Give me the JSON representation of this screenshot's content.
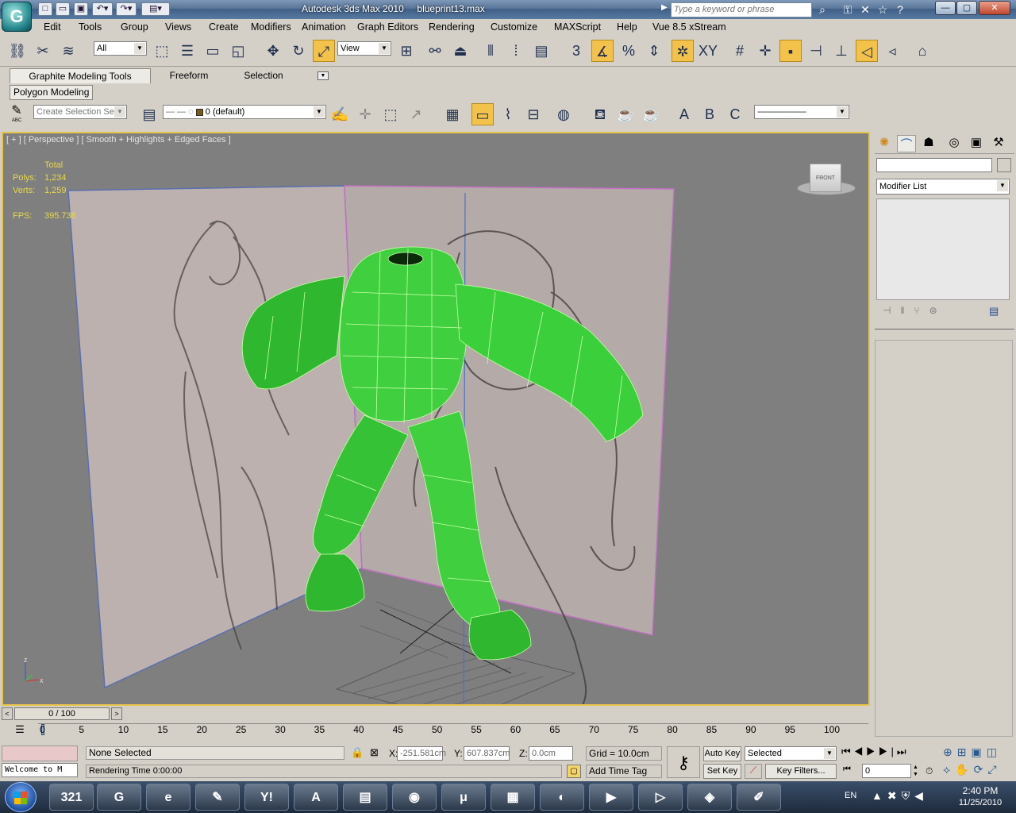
{
  "title": {
    "app": "Autodesk 3ds Max  2010",
    "file": "blueprint13.max",
    "logo": "G"
  },
  "search": {
    "placeholder": "Type a keyword or phrase"
  },
  "menu": [
    "Edit",
    "Tools",
    "Group",
    "Views",
    "Create",
    "Modifiers",
    "Animation",
    "Graph Editors",
    "Rendering",
    "Customize",
    "MAXScript",
    "Help",
    "Vue 8.5 xStream"
  ],
  "toolbar": {
    "selection_filter": "All",
    "ref_coord": "View",
    "snap_3": "3"
  },
  "ribbon": {
    "tabs": [
      "Graphite Modeling Tools",
      "Freeform",
      "Selection"
    ],
    "panel": "Polygon Modeling"
  },
  "toolbar2": {
    "selection_set_placeholder": "Create Selection Se",
    "layer": "0 (default)",
    "abc_label": "ABC"
  },
  "viewport": {
    "label": "[ + ] [ Perspective ] [ Smooth + Highlights + Edged Faces ]",
    "stats": {
      "total": "Total",
      "polys_label": "Polys:",
      "polys": "1,234",
      "verts_label": "Verts:",
      "verts": "1,259",
      "fps_label": "FPS:",
      "fps": "395.738"
    },
    "viewcube": "FRONT",
    "axes": {
      "z": "z",
      "x": "x"
    },
    "accent": "#e9c44a",
    "mesh_color": "#3fcf3f"
  },
  "command_panel": {
    "modifier_list": "Modifier List"
  },
  "timeline": {
    "frame": "0 / 100",
    "ticks": [
      "0",
      "5",
      "10",
      "15",
      "20",
      "25",
      "30",
      "35",
      "40",
      "45",
      "50",
      "55",
      "60",
      "65",
      "70",
      "75",
      "80",
      "85",
      "90",
      "95",
      "100"
    ]
  },
  "status": {
    "script": "Welcome to M",
    "selection": "None Selected",
    "rendering": "Rendering Time  0:00:00",
    "x_label": "X:",
    "x": "-251.581cm",
    "y_label": "Y:",
    "y": "607.837cm",
    "z_label": "Z:",
    "z": "0.0cm",
    "grid": "Grid = 10.0cm",
    "add_time_tag": "Add Time Tag",
    "auto_key": "Auto Key",
    "set_key": "Set Key",
    "key_mode": "Selected",
    "key_filters": "Key Filters...",
    "current_frame": "0"
  },
  "taskbar": {
    "lang": "EN",
    "time": "2:40 PM",
    "date": "11/25/2010",
    "apps": [
      "321",
      "G",
      "e",
      "✎",
      "Y!",
      "A",
      "▤",
      "◉",
      "μ",
      "▦",
      "◐",
      "▶",
      "▷",
      "◈",
      "✐"
    ]
  }
}
